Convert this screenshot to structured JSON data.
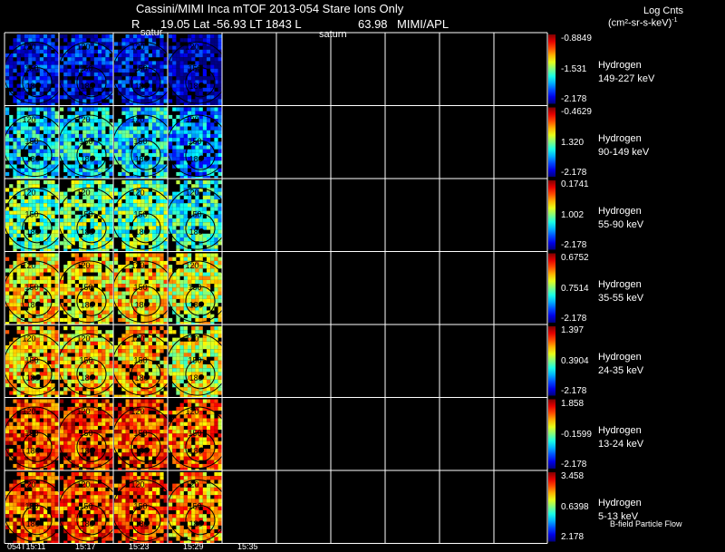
{
  "header": {
    "title": "Cassini/MIMI Inca mTOF  2013-054   Stare   Ions Only",
    "r_label": "R",
    "lat_lt_l": "19.05 Lat -56.93 LT 1843 L",
    "l_value": "63.98",
    "source": "MIMI/APL",
    "units_line1": "Log Cnts",
    "units_line2": "(cm²-sr-s-keV)",
    "units_sup": "-1"
  },
  "overlay_labels": {
    "saturn_1": "satur",
    "saturn_2": "saturn"
  },
  "rows": [
    {
      "species": "Hydrogen",
      "energy": "149-227 keV",
      "cbar_max": "-0.8849",
      "cbar_mid": "-1.531",
      "cbar_min": "-2.178"
    },
    {
      "species": "Hydrogen",
      "energy": "90-149 keV",
      "cbar_max": "-0.4629",
      "cbar_mid": "1.320",
      "cbar_min": "-2.178"
    },
    {
      "species": "Hydrogen",
      "energy": "55-90 keV",
      "cbar_max": "0.1741",
      "cbar_mid": "1.002",
      "cbar_min": "-2.178"
    },
    {
      "species": "Hydrogen",
      "energy": "35-55 keV",
      "cbar_max": "0.6752",
      "cbar_mid": "0.7514",
      "cbar_min": "-2.178"
    },
    {
      "species": "Hydrogen",
      "energy": "24-35 keV",
      "cbar_max": "1.397",
      "cbar_mid": "0.3904",
      "cbar_min": "-2.178"
    },
    {
      "species": "Hydrogen",
      "energy": "13-24 keV",
      "cbar_max": "1.858",
      "cbar_mid": "-0.1599",
      "cbar_min": "-2.178"
    },
    {
      "species": "Hydrogen",
      "energy": "5-13 keV",
      "cbar_max": "3.458",
      "cbar_mid": "0.6398",
      "cbar_min": "2.178"
    }
  ],
  "panel_labels": [
    "120",
    "150",
    "180"
  ],
  "time_labels": [
    "054T15:11",
    "15:17",
    "15:23",
    "15:29",
    "15:35"
  ],
  "footer_note": "B-field Particle Flow",
  "colors": {
    "background": "#000000",
    "grid_lines": "#ffffff",
    "text": "#ffffff"
  }
}
